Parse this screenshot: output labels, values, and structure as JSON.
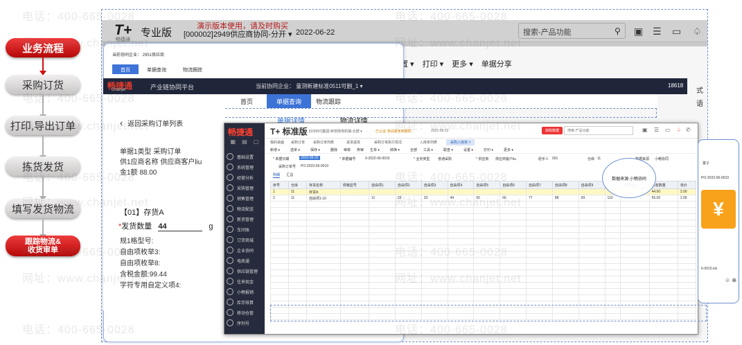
{
  "flow": {
    "steps": [
      {
        "label": "业务流程"
      },
      {
        "label": "采购订货"
      },
      {
        "label": "打印,导出订单"
      },
      {
        "label": "拣货发货"
      },
      {
        "label": "填写发货物流"
      },
      {
        "label": "跟踪物流&\n收货审单"
      }
    ]
  },
  "back_window": {
    "logo": "T+",
    "logo_sub": "畅捷通",
    "edition": "专业版",
    "notice": "演示版本使用，请及时购买",
    "company": "[000002]2949供应商协同-分开 ▾",
    "date": "2022-06-22",
    "search_placeholder": "搜索-产品功能",
    "menu": [
      "设置 ▾",
      "打印 ▾",
      "更多 ▾",
      "单据分享"
    ],
    "right_partial": [
      "式",
      "语"
    ]
  },
  "mid_window": {
    "mini_company": "当前协同企业：  2951供应商",
    "mini_tabs": [
      "首页",
      "单据查询",
      "物流跟踪"
    ]
  },
  "chanjet_bar": {
    "logo": "畅捷通",
    "logo_sub": "Chanjet",
    "platform": "产业链协同平台",
    "company": "当前协同企业：  童测新建标准0511可删_1  ▾",
    "user": "18618"
  },
  "nav_tabs": [
    "首页",
    "单据查询",
    "物流跟踪"
  ],
  "return_panel": {
    "back_label": "返回采购订单列表",
    "lines": [
      "单据1类型 采购订单",
      "供1应商名称 供应商客户liu",
      "金1额 88.00"
    ],
    "item_title": "【01】存货A",
    "qty_label": "发货数量",
    "qty_value": "44",
    "qty_unit": "g",
    "specs": [
      "规1格型号:",
      "自由项枚举3:",
      "自由项枚举8:",
      "含税金额:99.44",
      "字符专用自定义项4:"
    ]
  },
  "detail_tabs": [
    "单据详情",
    "物流详情"
  ],
  "front_window": {
    "brand": "畅捷通",
    "title": "T+ 标准版",
    "company": "[028997]集团-新管院电机销-北部 ▾",
    "notice": "已认证 测试版使用期限...",
    "date": "2022-06-22",
    "buy_btn": "获取数据",
    "search_placeholder": "搜索-产品功能",
    "side_items": [
      "基础设置",
      "系统管理",
      "经营分析",
      "采购管理",
      "销售管理",
      "物流配送",
      "新资管理",
      "车间账",
      "订货商城",
      "企业协同",
      "电商通",
      "供应链管理",
      "往来现金",
      "小畅报销",
      "库存核算",
      "移动仓管",
      "序列号"
    ],
    "tabs": [
      "我的桌面",
      "采购订单",
      "采购订单列表",
      "进货退货",
      "采购订单执行情况",
      "入库单列表",
      "采购入库单 ×"
    ],
    "toolbar": [
      "新增 ▾",
      "选单 ▾",
      "保存 ▾",
      "删除",
      "审核",
      "弃审",
      "生单 ▾",
      "转换 ▾",
      "全部",
      "工具 ▾",
      "联查 ▾",
      "设置 ▾",
      "打印 ▾",
      "更多 ▾"
    ],
    "form": {
      "date_label": "* 单据日期",
      "date_value": "2022-06-22",
      "code_label": "* 单据编号",
      "code_value": "0-2022-06-0015",
      "type_label": "* 业务类型",
      "type_value": "普通采购",
      "supplier_label": "* 供应商",
      "supplier_value": "供应商客户liu",
      "handler_label": "经手人",
      "handler_value": "001",
      "warehouse_label": "仓库",
      "warehouse_value": "11",
      "source_label": "数据来源",
      "source_value": "小畅协同",
      "order_label": "采购订单号",
      "order_value": "PO-2022-06-0019"
    },
    "subtabs": [
      "明细",
      "汇总"
    ],
    "callout": "数据来源 小畅协同",
    "columns": [
      "序号",
      "仓库",
      "存货名称",
      "规格型号",
      "自由项1",
      "自由项2",
      "自由项3",
      "自由项4",
      "自由项5",
      "自由项6",
      "自由项7",
      "自由项8",
      "自由项9",
      "",
      "含税单价",
      "实收数量",
      "单价"
    ],
    "rows": [
      [
        "1",
        "11",
        "存货A",
        "",
        "",
        "",
        "",
        "",
        "",
        "",
        "",
        "",
        "",
        "",
        "",
        "44.00",
        "2.00"
      ],
      [
        "2",
        "11",
        "自由项1-10",
        "",
        "11",
        "22",
        "33",
        "44",
        "55",
        "66",
        "77",
        "88",
        "99",
        "110",
        "",
        "55.00",
        "2.00"
      ]
    ]
  },
  "phone": {
    "top_label": "童子",
    "file1": "PO-2022-06-0010",
    "yuan": "¥",
    "file2": "6-0010.xls",
    "emoji": "☺ ⊕"
  },
  "watermark": {
    "phone": "电话：400-665-0028",
    "site": "网址：www.chanjet.net"
  },
  "colors": {
    "accent_red": "#d01010",
    "nav_blue": "#3c73d6",
    "dark_bar": "#20263a"
  }
}
